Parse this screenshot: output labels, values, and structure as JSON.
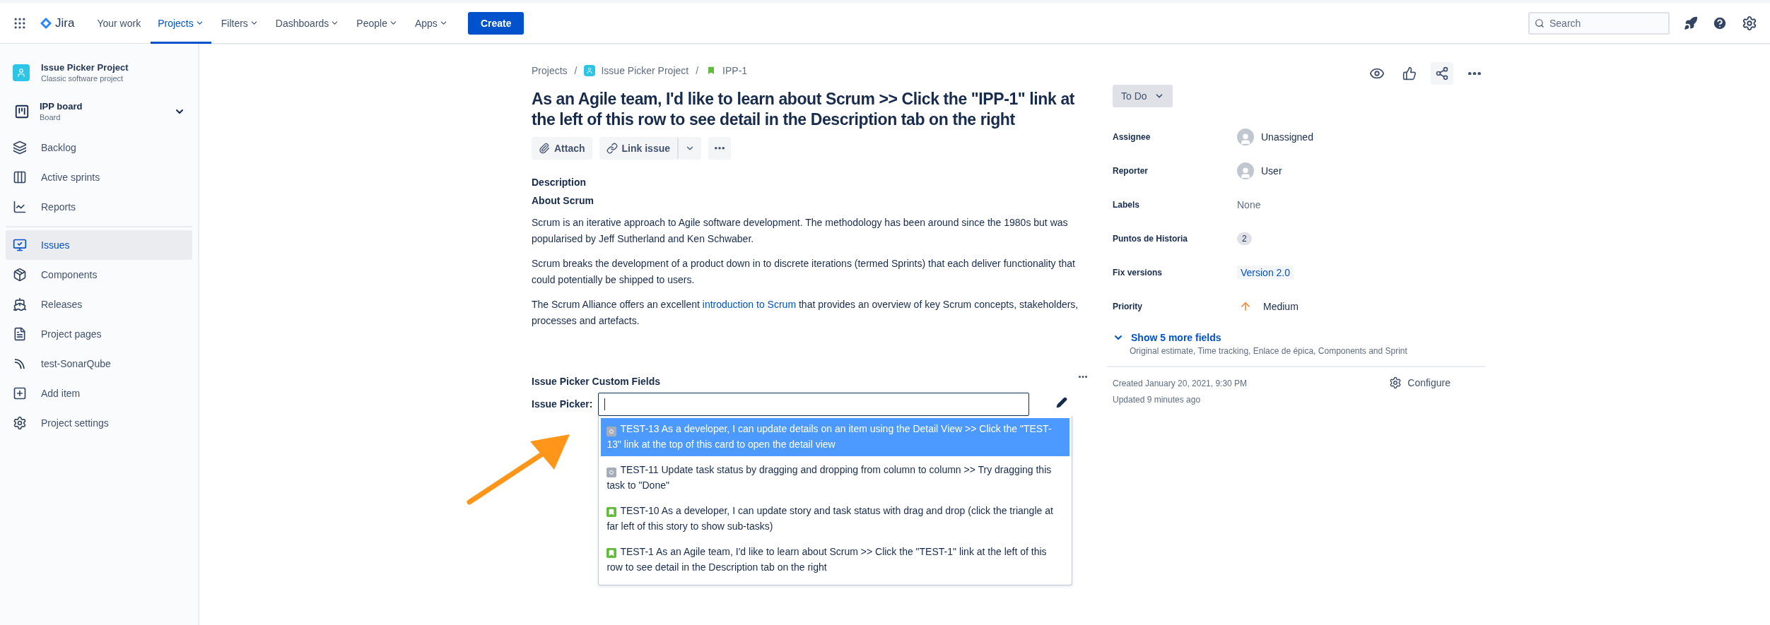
{
  "topnav": {
    "product": "Jira",
    "items": [
      {
        "label": "Your work",
        "selected": false,
        "has_menu": false
      },
      {
        "label": "Projects",
        "selected": true,
        "has_menu": true
      },
      {
        "label": "Filters",
        "selected": false,
        "has_menu": true
      },
      {
        "label": "Dashboards",
        "selected": false,
        "has_menu": true
      },
      {
        "label": "People",
        "selected": false,
        "has_menu": true
      },
      {
        "label": "Apps",
        "selected": false,
        "has_menu": true
      }
    ],
    "create": "Create",
    "search": {
      "placeholder": "Search"
    }
  },
  "sidebar": {
    "project": {
      "name": "Issue Picker Project",
      "type": "Classic software project"
    },
    "board": {
      "name": "IPP board",
      "type": "Board"
    },
    "groups": [
      {
        "items": [
          {
            "label": "Backlog",
            "selected": false
          },
          {
            "label": "Active sprints",
            "selected": false
          },
          {
            "label": "Reports",
            "selected": false
          }
        ]
      },
      {
        "items": [
          {
            "label": "Issues",
            "selected": true
          },
          {
            "label": "Components",
            "selected": false
          },
          {
            "label": "Releases",
            "selected": false
          },
          {
            "label": "Project pages",
            "selected": false
          },
          {
            "label": "test-SonarQube",
            "selected": false
          },
          {
            "label": "Add item",
            "selected": false
          },
          {
            "label": "Project settings",
            "selected": false
          }
        ]
      }
    ]
  },
  "breadcrumbs": [
    {
      "label": "Projects",
      "kind": "text"
    },
    {
      "label": "Issue Picker Project",
      "kind": "project",
      "separator": "/"
    },
    {
      "label": "IPP-1",
      "kind": "story",
      "separator": "/"
    }
  ],
  "issue": {
    "title": "As an Agile team, I'd like to learn about Scrum >> Click the \"IPP-1\" link at the left of this row to see detail in the Description tab on the right",
    "actions": {
      "attach": "Attach",
      "link": "Link issue"
    },
    "description": {
      "heading": "Description",
      "subheading": "About Scrum",
      "paragraphs": [
        {
          "text": "Scrum is an iterative approach to Agile software development. The methodology has been around since the 1980s but was popularised by Jeff Sutherland and Ken Schwaber."
        },
        {
          "text": "Scrum breaks the development of a product down in to discrete iterations (termed Sprints) that each deliver functionality that could potentially be shipped to users."
        },
        {
          "text": "The Scrum Alliance offers an excellent ",
          "link": "introduction to Scrum",
          "after": " that provides an overview of key Scrum concepts, stakeholders, processes and artefacts."
        }
      ]
    }
  },
  "custom_fields": {
    "title": "Issue Picker Custom Fields",
    "label": "Issue Picker:",
    "options": [
      {
        "text": "TEST-13 As a developer, I can update details on an item using the Detail View >> Click the \"TEST-13\" link at the top of this card to open the detail view",
        "kind": "task",
        "selected": true
      },
      {
        "text": "TEST-11 Update task status by dragging and dropping from column to column >> Try dragging this task to \"Done\"",
        "kind": "task",
        "selected": false
      },
      {
        "text": "TEST-10 As a developer, I can update story and task status with drag and drop (click the triangle at far left of this story to show sub-tasks)",
        "kind": "story",
        "selected": false
      },
      {
        "text": "TEST-1 As an Agile team, I'd like to learn about Scrum >> Click the \"TEST-1\" link at the left of this row to see detail in the Description tab on the right",
        "kind": "story",
        "selected": false
      }
    ]
  },
  "status": {
    "label": "To Do"
  },
  "fields": [
    {
      "label": "Assignee",
      "value": "Unassigned",
      "kind": "avatar"
    },
    {
      "label": "Reporter",
      "value": "User",
      "kind": "avatar"
    },
    {
      "label": "Labels",
      "value": "None",
      "kind": "empty"
    },
    {
      "label": "Puntos de Historia",
      "value": "2",
      "kind": "badge"
    },
    {
      "label": "Fix versions",
      "value": "Version 2.0",
      "kind": "version"
    },
    {
      "label": "Priority",
      "value": "Medium",
      "kind": "priority"
    }
  ],
  "more_fields": {
    "label": "Show 5 more fields",
    "list": "Original estimate, Time tracking, Enlace de épica, Components and Sprint"
  },
  "created": "Created January 20, 2021, 9:30 PM",
  "updated": "Updated 9 minutes ago",
  "configure": "Configure"
}
